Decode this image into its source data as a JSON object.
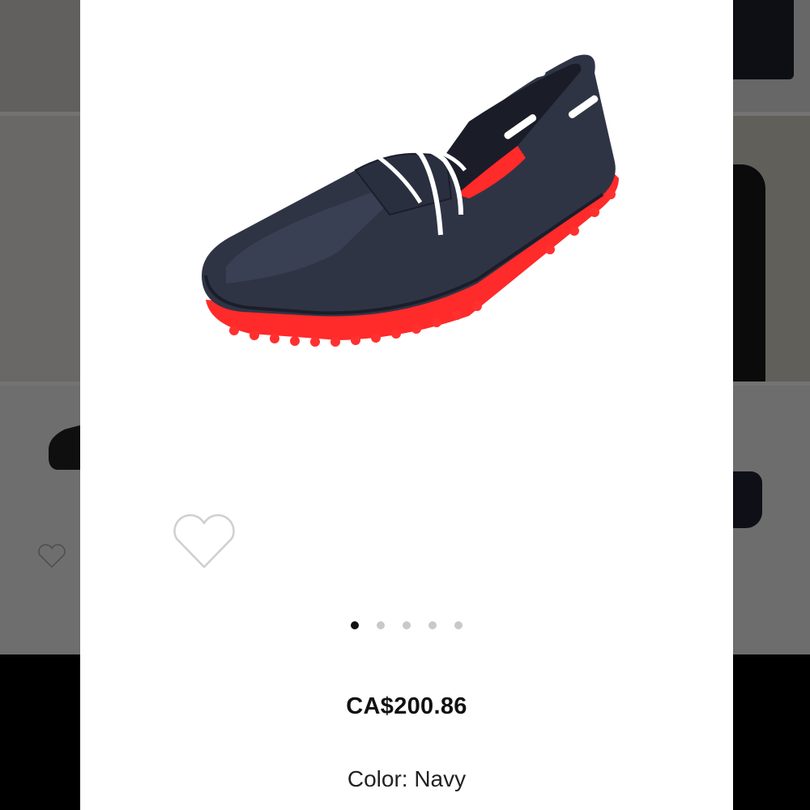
{
  "product": {
    "image_icon": "navy-driving-loafer-image",
    "price": "CA$200.86",
    "color_line": "Color: Navy"
  },
  "wishlist": {
    "icon": "heart-outline-icon"
  },
  "carousel": {
    "total_slides": 5,
    "active_slide": 1
  },
  "colors": {
    "shoe_body": "#2f3445",
    "sole_accent": "#ff2a2a",
    "lace": "#ffffff",
    "dot_active": "#111111",
    "dot_inactive": "#c9c9c9"
  }
}
